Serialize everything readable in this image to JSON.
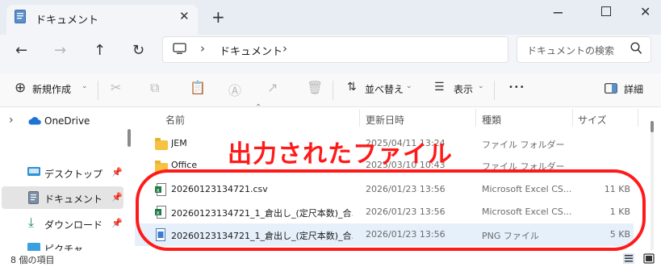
{
  "window": {
    "tab_title": "ドキュメント",
    "close_glyph": "✕",
    "new_tab_glyph": "+",
    "minimize_glyph": "─",
    "window_close_glyph": "✕"
  },
  "nav": {
    "back": "←",
    "forward": "→",
    "up": "↑",
    "refresh": "↻",
    "path_segments": [
      "ドキュメント"
    ],
    "separator": "›",
    "search_placeholder": "ドキュメントの検索"
  },
  "toolbar": {
    "new_label": "新規作成",
    "sort_label": "並べ替え",
    "view_label": "表示",
    "more_label": "•••",
    "details_label": "詳細"
  },
  "sidebar": {
    "items": [
      {
        "label": "OneDrive",
        "icon": "cloud-icon",
        "expander": "›"
      },
      {
        "label": "デスクトップ",
        "icon": "desktop-icon",
        "pinned": true
      },
      {
        "label": "ドキュメント",
        "icon": "document-icon",
        "pinned": true,
        "selected": true
      },
      {
        "label": "ダウンロード",
        "icon": "download-icon",
        "pinned": true
      },
      {
        "label": "ピクチャ",
        "icon": "pictures-icon",
        "pinned": true
      }
    ]
  },
  "columns": {
    "name": "名前",
    "date": "更新日時",
    "type": "種類",
    "size": "サイズ"
  },
  "files": [
    {
      "name": "JEM",
      "date": "2025/04/11 13:24",
      "type": "ファイル フォルダー",
      "size": "",
      "icon": "folder-icon"
    },
    {
      "name": "Office",
      "date": "2025/03/10 10:43",
      "type": "ファイル フォルダー",
      "size": "",
      "icon": "folder-icon"
    },
    {
      "name": "20260123134721.csv",
      "date": "2026/01/23 13:56",
      "type": "Microsoft Excel CS...",
      "size": "11 KB",
      "icon": "excel-csv-icon"
    },
    {
      "name": "20260123134721_1_倉出し_(定尺本数)_合...",
      "date": "2026/01/23 13:56",
      "type": "Microsoft Excel CS...",
      "size": "1 KB",
      "icon": "excel-csv-icon"
    },
    {
      "name": "20260123134721_1_倉出し_(定尺本数)_合...",
      "date": "2026/01/23 13:56",
      "type": "PNG ファイル",
      "size": "5 KB",
      "icon": "png-icon",
      "selected": true
    }
  ],
  "annotation": {
    "text": "出力されたファイル",
    "color": "#ff1a1a"
  },
  "status": {
    "count_text": "8 個の項目"
  }
}
